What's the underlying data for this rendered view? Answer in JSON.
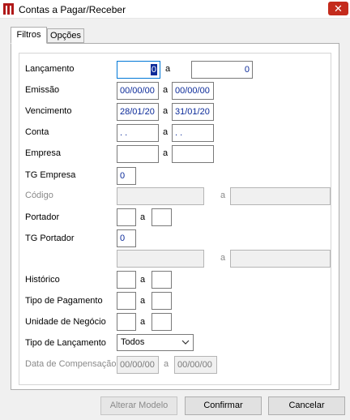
{
  "window": {
    "title": "Contas a Pagar/Receber",
    "close_glyph": "✕",
    "icon": "app-logo-icon",
    "close_color": "#c42b1c"
  },
  "tabs": [
    {
      "label": "Filtros",
      "active": true
    },
    {
      "label": "Opções",
      "active": false
    }
  ],
  "filters": {
    "lancamento": {
      "label": "Lançamento",
      "from": "0",
      "sep": "a",
      "to": "0"
    },
    "emissao": {
      "label": "Emissão",
      "from": "00/00/00",
      "sep": "a",
      "to": "00/00/00"
    },
    "vencimento": {
      "label": "Vencimento",
      "from": "28/01/20",
      "sep": "a",
      "to": "31/01/20"
    },
    "conta": {
      "label": "Conta",
      "from": ". .",
      "sep": "a",
      "to": ". ."
    },
    "empresa": {
      "label": "Empresa",
      "from": "",
      "sep": "a",
      "to": ""
    },
    "tg_empresa": {
      "label": "TG Empresa",
      "value": "0"
    },
    "codigo": {
      "label": "Código",
      "from": "",
      "sep": "a",
      "to": "",
      "enabled": false
    },
    "portador": {
      "label": "Portador",
      "from": "",
      "sep": "a",
      "to": ""
    },
    "tg_portador": {
      "label": "TG Portador",
      "value": "0"
    },
    "portador_range": {
      "from": "",
      "sep": "a",
      "to": "",
      "enabled": false
    },
    "historico": {
      "label": "Histórico",
      "from": "",
      "sep": "a",
      "to": ""
    },
    "tipo_pagamento": {
      "label": "Tipo de Pagamento",
      "from": "",
      "sep": "a",
      "to": ""
    },
    "unidade_negocio": {
      "label": "Unidade de Negócio",
      "from": "",
      "sep": "a",
      "to": ""
    },
    "tipo_lancamento": {
      "label": "Tipo de Lançamento",
      "value": "Todos"
    },
    "data_compensacao": {
      "label": "Data de Compensação",
      "from": "00/00/00",
      "sep": "a",
      "to": "00/00/00",
      "enabled": false
    }
  },
  "buttons": {
    "alterar": "Alterar Modelo",
    "confirmar": "Confirmar",
    "cancelar": "Cancelar"
  }
}
